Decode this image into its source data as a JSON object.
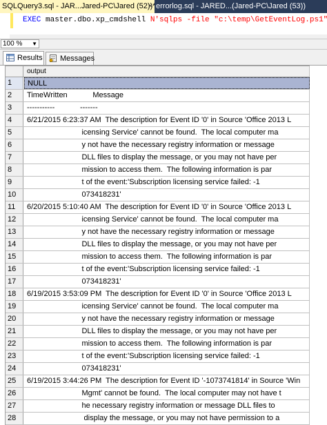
{
  "doc_tabs": {
    "active": "SQLQuery3.sql - JAR...Jared-PC\\Jared (52))*",
    "close_glyph": "×",
    "inactive": "errorlog.sql - JARED...(Jared-PC\\Jared (53))"
  },
  "editor": {
    "code_exec": "EXEC",
    "code_obj": " master.dbo.xp_cmdshell",
    "code_str": " N'sqlps -file \"c:\\temp\\GetEventLog.ps1\"'",
    "code_end": ";"
  },
  "zoom": {
    "value": "100 %"
  },
  "result_tabs": {
    "results": "Results",
    "messages": "Messages"
  },
  "grid": {
    "column": "output",
    "rows": [
      {
        "n": "1",
        "v": "NULL"
      },
      {
        "n": "2",
        "v": "TimeWritten            Message"
      },
      {
        "n": "3",
        "v": "-----------            -------"
      },
      {
        "n": "4",
        "v": "6/21/2015 6:23:37 AM  The description for Event ID '0' in Source 'Office 2013 L"
      },
      {
        "n": "5",
        "v": "                          icensing Service' cannot be found.  The local computer ma"
      },
      {
        "n": "6",
        "v": "                          y not have the necessary registry information or message"
      },
      {
        "n": "7",
        "v": "                          DLL files to display the message, or you may not have per"
      },
      {
        "n": "8",
        "v": "                          mission to access them.  The following information is par"
      },
      {
        "n": "9",
        "v": "                          t of the event:'Subscription licensing service failed: -1"
      },
      {
        "n": "10",
        "v": "                          073418231'"
      },
      {
        "n": "11",
        "v": "6/20/2015 5:10:40 AM  The description for Event ID '0' in Source 'Office 2013 L"
      },
      {
        "n": "12",
        "v": "                          icensing Service' cannot be found.  The local computer ma"
      },
      {
        "n": "13",
        "v": "                          y not have the necessary registry information or message"
      },
      {
        "n": "14",
        "v": "                          DLL files to display the message, or you may not have per"
      },
      {
        "n": "15",
        "v": "                          mission to access them.  The following information is par"
      },
      {
        "n": "16",
        "v": "                          t of the event:'Subscription licensing service failed: -1"
      },
      {
        "n": "17",
        "v": "                          073418231'"
      },
      {
        "n": "18",
        "v": "6/19/2015 3:53:09 PM  The description for Event ID '0' in Source 'Office 2013 L"
      },
      {
        "n": "19",
        "v": "                          icensing Service' cannot be found.  The local computer ma"
      },
      {
        "n": "20",
        "v": "                          y not have the necessary registry information or message"
      },
      {
        "n": "21",
        "v": "                          DLL files to display the message, or you may not have per"
      },
      {
        "n": "22",
        "v": "                          mission to access them.  The following information is par"
      },
      {
        "n": "23",
        "v": "                          t of the event:'Subscription licensing service failed: -1"
      },
      {
        "n": "24",
        "v": "                          073418231'"
      },
      {
        "n": "25",
        "v": "6/19/2015 3:44:26 PM  The description for Event ID '-1073741814' in Source 'Win"
      },
      {
        "n": "26",
        "v": "                          Mgmt' cannot be found.  The local computer may not have t"
      },
      {
        "n": "27",
        "v": "                          he necessary registry information or message DLL files to"
      },
      {
        "n": "28",
        "v": "                           display the message, or you may not have permission to a"
      }
    ]
  },
  "colors": {
    "tab_strip": "#2b3c59",
    "active_tab": "#fff6bf",
    "keyword": "#0000ff",
    "string": "#ff0000",
    "selection": "#aab4d2"
  },
  "icons": [
    "close-icon",
    "results-grid-icon",
    "messages-icon",
    "dropdown-arrow-icon"
  ]
}
